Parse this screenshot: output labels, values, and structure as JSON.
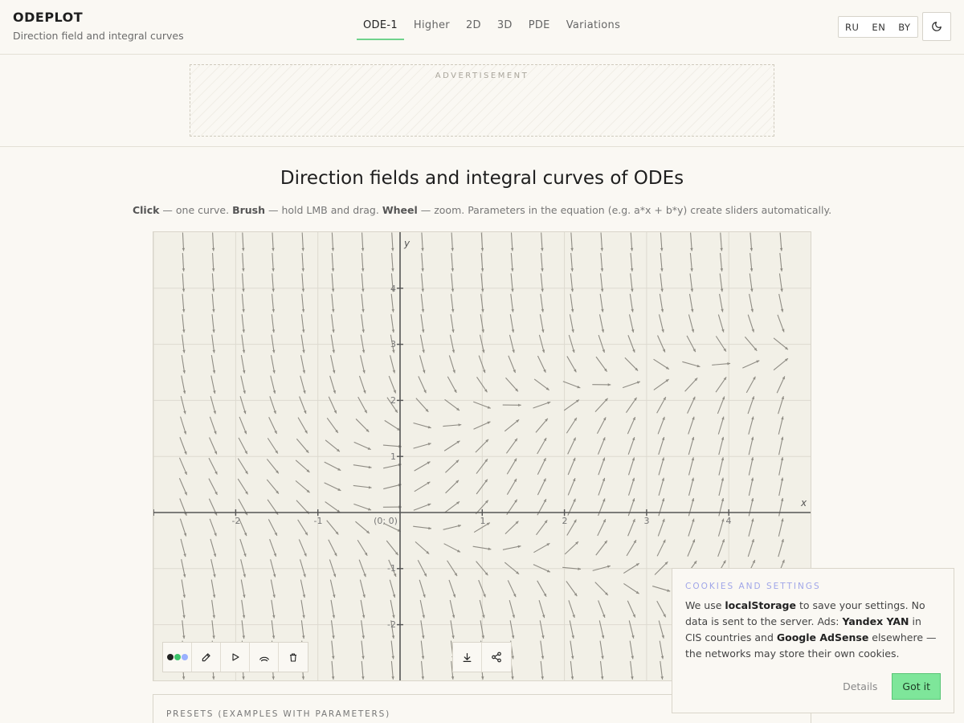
{
  "header": {
    "brand": "ODEPLOT",
    "subtitle": "Direction field and integral curves",
    "tabs": [
      {
        "label": "ODE-1",
        "active": true
      },
      {
        "label": "Higher"
      },
      {
        "label": "2D"
      },
      {
        "label": "3D"
      },
      {
        "label": "PDE"
      },
      {
        "label": "Variations"
      }
    ],
    "languages": [
      "RU",
      "EN",
      "BY"
    ],
    "theme_icon": "moon-icon"
  },
  "ad": {
    "label": "ADVERTISEMENT"
  },
  "main": {
    "title": "Direction fields and integral curves of ODEs",
    "hint": {
      "click_b": "Click",
      "click_t": " — one curve. ",
      "brush_b": "Brush",
      "brush_t": " — hold LMB and drag. ",
      "wheel_b": "Wheel",
      "wheel_t": " — zoom. Parameters in the equation (e.g. a*x + b*y) create sliders automatically."
    }
  },
  "plot": {
    "x_axis_label": "x",
    "y_axis_label": "y",
    "origin_label": "(0; 0)",
    "x_ticks": [
      "-2",
      "-1",
      "1",
      "2",
      "3",
      "4"
    ],
    "y_ticks": [
      "4",
      "3",
      "2",
      "1",
      "-1",
      "-2"
    ],
    "colors": {
      "background": "#f2f0e7",
      "grid": "#dddad0",
      "axis": "#555555",
      "arrow": "#8f8c84"
    },
    "toolbar_left": [
      "color-palette-icon",
      "pencil-icon",
      "play-icon",
      "brush-icon",
      "trash-icon"
    ],
    "toolbar_right": [
      "download-icon",
      "share-icon"
    ],
    "palette_colors": [
      "#222222",
      "#3cc46a",
      "#9ab0ff"
    ]
  },
  "presets": {
    "label": "PRESETS (EXAMPLES WITH PARAMETERS)"
  },
  "cookie": {
    "title": "COOKIES AND SETTINGS",
    "t1": "We use ",
    "b1": "localStorage",
    "t2": " to save your settings. No data is sent to the server. Ads: ",
    "b2": "Yandex YAN",
    "t3": " in CIS countries and ",
    "b3": "Google AdSense",
    "t4": " elsewhere — the networks may store their own cookies.",
    "details_label": "Details",
    "accept_label": "Got it"
  }
}
